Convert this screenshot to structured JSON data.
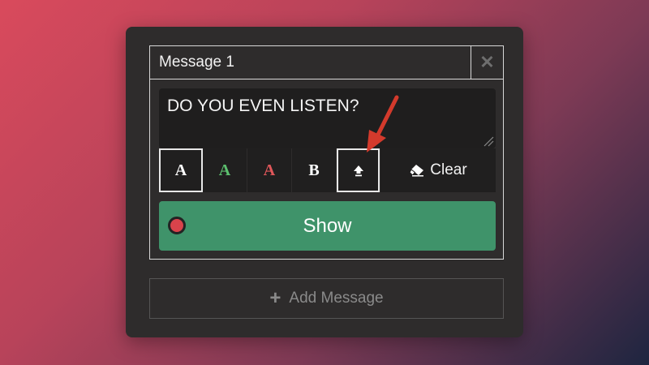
{
  "message_card": {
    "title": "Message 1",
    "close_icon": "close-icon",
    "text": "DO YOU EVEN LISTEN?",
    "toolbar": {
      "buttons": [
        {
          "label": "A",
          "color": "#ffffff",
          "selected": true,
          "name": "text-color-white-button"
        },
        {
          "label": "A",
          "color": "#5cbf6e",
          "selected": false,
          "name": "text-color-green-button"
        },
        {
          "label": "A",
          "color": "#e0575a",
          "selected": false,
          "name": "text-color-red-button"
        },
        {
          "label": "B",
          "color": "#ffffff",
          "selected": false,
          "name": "bold-button"
        }
      ],
      "upload_icon": "upload-icon",
      "upload_selected": true,
      "clear_label": "Clear",
      "clear_icon": "eraser-icon"
    },
    "show_label": "Show",
    "status_dot_color": "#d9434b",
    "show_color": "#3f936a"
  },
  "add_message_label": "Add Message",
  "annotation": {
    "arrow_color": "#d33a2c"
  }
}
